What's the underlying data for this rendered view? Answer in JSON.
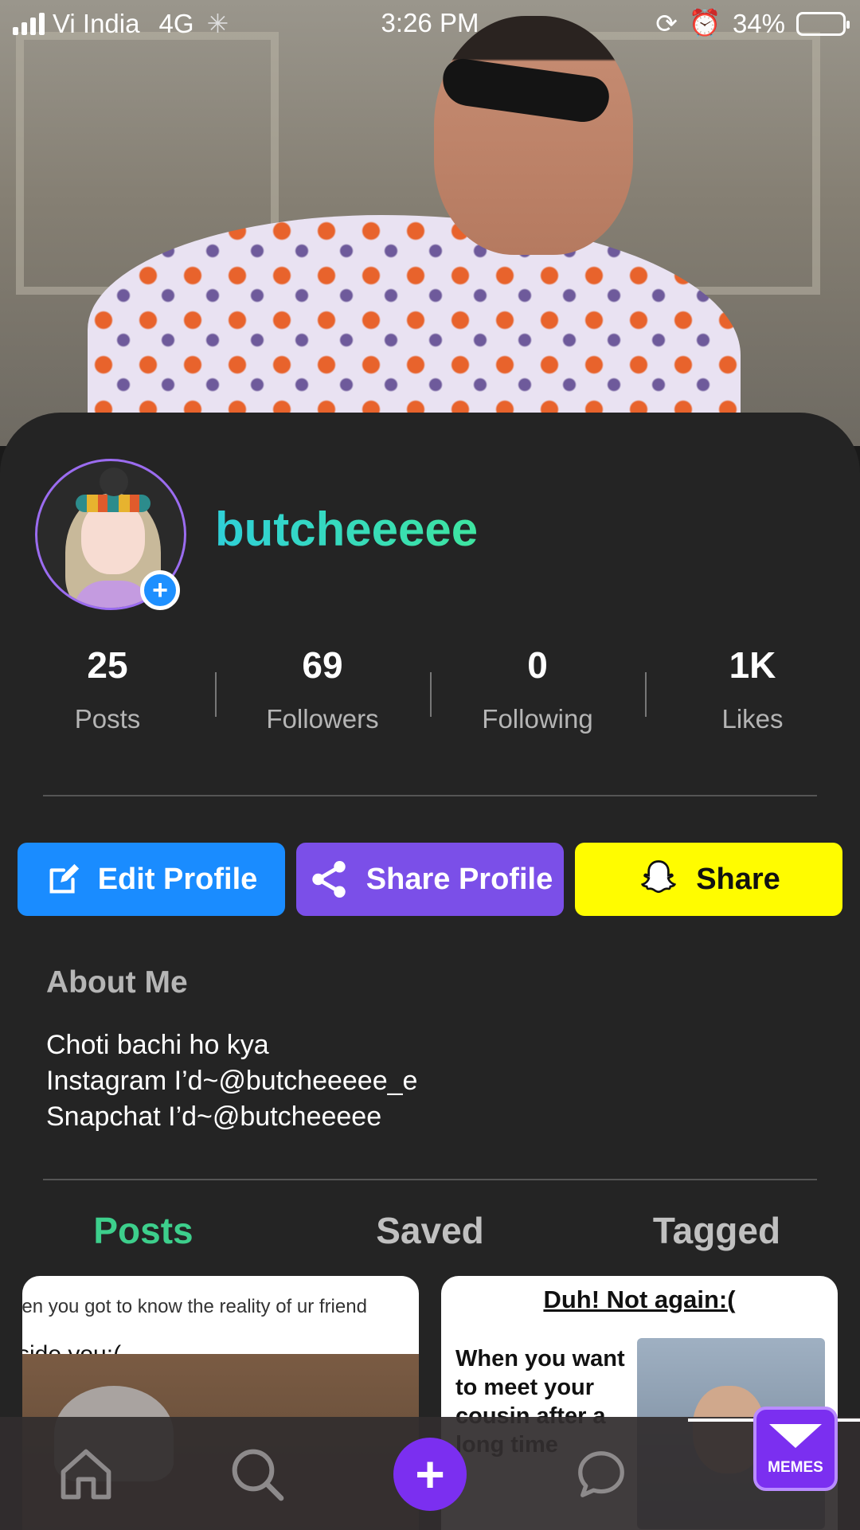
{
  "status_bar": {
    "carrier": "Vi India",
    "network": "4G",
    "time": "3:26 PM",
    "battery": "34%"
  },
  "profile": {
    "username": "butcheeeee"
  },
  "stats": [
    {
      "value": "25",
      "label": "Posts"
    },
    {
      "value": "69",
      "label": "Followers"
    },
    {
      "value": "0",
      "label": "Following"
    },
    {
      "value": "1K",
      "label": "Likes"
    }
  ],
  "buttons": {
    "edit": "Edit Profile",
    "share_profile": "Share Profile",
    "share": "Share"
  },
  "about": {
    "title": "About Me",
    "lines": [
      "Choti bachi ho kya",
      "Instagram I’d~@butcheeeee_e",
      "Snapchat I’d~@butcheeeee"
    ]
  },
  "tabs": [
    {
      "label": "Posts",
      "active": true
    },
    {
      "label": "Saved",
      "active": false
    },
    {
      "label": "Tagged",
      "active": false
    }
  ],
  "posts": [
    {
      "caption": "hen you got to know the reality of ur friend",
      "headline": "side you:("
    },
    {
      "title": "Duh! Not again:(",
      "text": "When you want to meet your cousin after a long time"
    }
  ],
  "nav": {
    "items": [
      "home-icon",
      "search-icon",
      "plus-icon",
      "chat-icon",
      "profile-icon"
    ]
  },
  "badge": {
    "memes": "MEMES"
  },
  "colors": {
    "accent_purple": "#7b4fe8",
    "accent_blue": "#1a8cff",
    "snap_yellow": "#fffc00",
    "active_tab": "#3dcf8c"
  }
}
